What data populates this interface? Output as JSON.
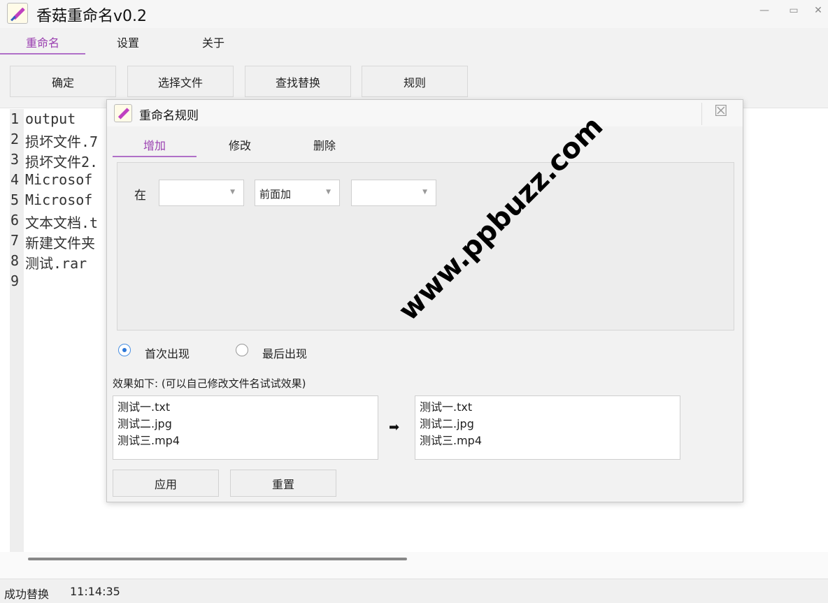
{
  "window": {
    "title": "香菇重命名v0.2",
    "min_glyph": "—",
    "max_glyph": "▭",
    "close_glyph": "✕"
  },
  "main_tabs": [
    {
      "label": "重命名",
      "active": true
    },
    {
      "label": "设置",
      "active": false
    },
    {
      "label": "关于",
      "active": false
    }
  ],
  "toolbar": {
    "ok_label": "确定",
    "choose_label": "选择文件",
    "replace_label": "查找替换",
    "rules_label": "规则"
  },
  "editor": {
    "lines": [
      {
        "num": "1",
        "text": "output"
      },
      {
        "num": "2",
        "text": "损坏文件.7"
      },
      {
        "num": "3",
        "text": "损坏文件2."
      },
      {
        "num": "4",
        "text": "Microsof"
      },
      {
        "num": "5",
        "text": "Microsof"
      },
      {
        "num": "6",
        "text": "文本文档.t"
      },
      {
        "num": "7",
        "text": "新建文件夹"
      },
      {
        "num": "8",
        "text": "测试.rar"
      },
      {
        "num": "9",
        "text": ""
      }
    ]
  },
  "status": {
    "message": "成功替换",
    "time": "11:14:35"
  },
  "dialog": {
    "title": "重命名规则",
    "close_glyph": "☒",
    "tabs": [
      {
        "label": "增加",
        "active": true
      },
      {
        "label": "修改",
        "active": false
      },
      {
        "label": "删除",
        "active": false
      }
    ],
    "at_label": "在",
    "combo1_value": "",
    "combo2_value": "前面加",
    "combo3_value": "",
    "combo_arrow": "▼",
    "radio_first": "首次出现",
    "radio_last": "最后出现",
    "radio_selected": "首次出现",
    "effect_label": "效果如下:  (可以自己修改文件名试试效果)",
    "preview_left": [
      "测试一.txt",
      "测试二.jpg",
      "测试三.mp4"
    ],
    "preview_arrow": "➡",
    "preview_right": [
      "测试一.txt",
      "测试二.jpg",
      "测试三.mp4"
    ],
    "apply_label": "应用",
    "reset_label": "重置"
  },
  "watermark": "www.ppbuzz.com",
  "colors": {
    "accent": "#9a3fb0",
    "radio_selected": "#2e78d8"
  }
}
